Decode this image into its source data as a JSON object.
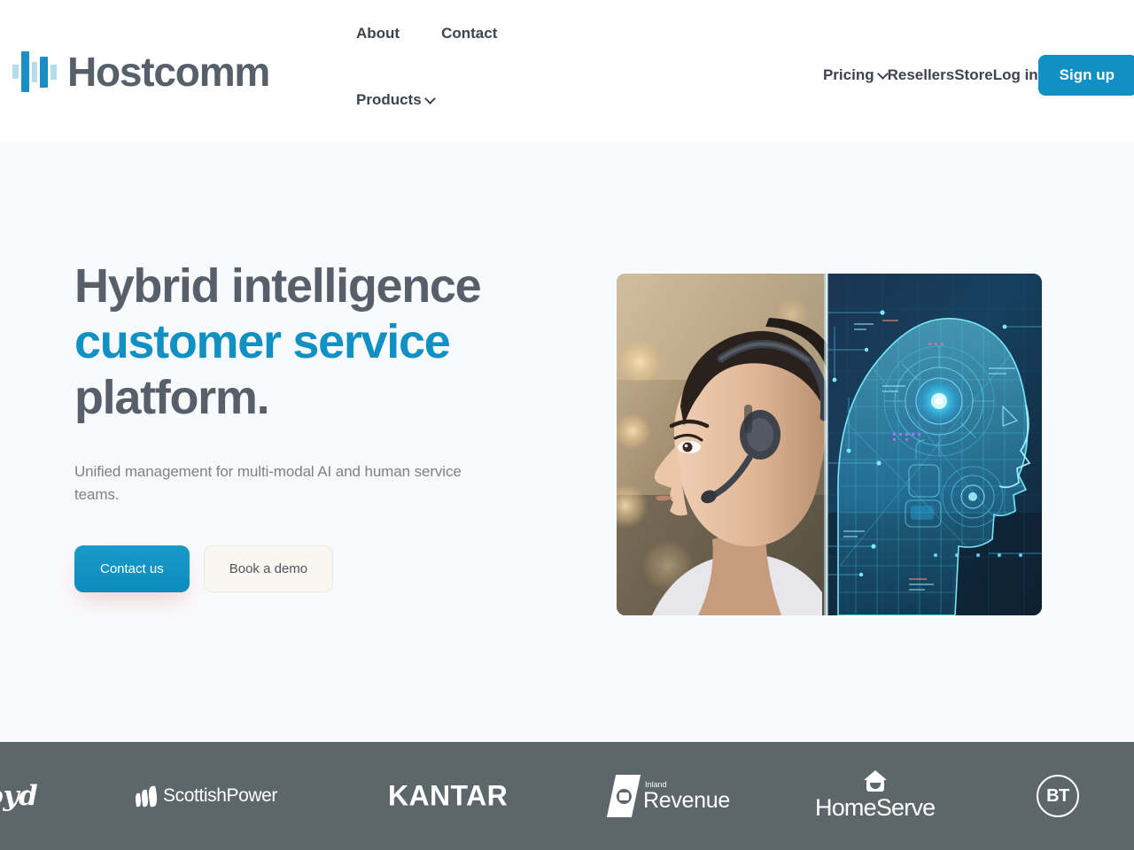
{
  "header": {
    "logo": {
      "wordmark": "Hostcomm",
      "bar_color_dark": "#1b8fc4",
      "bar_color_light": "#b4dced"
    },
    "nav_primary": [
      {
        "label": "About",
        "has_dropdown": false
      },
      {
        "label": "Contact",
        "has_dropdown": false
      },
      {
        "label": "Products",
        "has_dropdown": true
      }
    ],
    "nav_secondary": [
      {
        "label": "Pricing",
        "has_dropdown": true
      },
      {
        "label": "Resellers",
        "has_dropdown": false
      },
      {
        "label": "Store",
        "has_dropdown": false
      },
      {
        "label": "Log in",
        "has_dropdown": false
      }
    ],
    "signup_label": "Sign up",
    "signup_color": "#1190c4"
  },
  "hero": {
    "heading_line1": "Hybrid intelligence",
    "heading_line2": "customer service",
    "heading_line3": "platform.",
    "heading_accent_color": "#1190c4",
    "heading_color": "#57606a",
    "subtitle": "Unified management for multi-modal AI and human service teams.",
    "primary_cta": "Contact us",
    "secondary_cta": "Book a demo",
    "background_color": "#f9fafd",
    "image": {
      "alt": "Split composition: call centre agent wearing a headset on the left, glowing blue AI wireframe head on the right",
      "left_description": "woman with headset, warm bokeh office background",
      "right_description": "cyan digital wireframe head with circuit overlay"
    }
  },
  "logo_band": {
    "background_color": "#5c666b",
    "brands": [
      {
        "name": "Lloyds",
        "visible_text": "loyd",
        "note": "clipped at left edge"
      },
      {
        "name": "ScottishPower",
        "visible_text": "ScottishPower"
      },
      {
        "name": "Kantar",
        "visible_text": "KANTAR"
      },
      {
        "name": "Inland Revenue",
        "visible_text_small": "Inland",
        "visible_text": "Revenue"
      },
      {
        "name": "HomeServe",
        "visible_text": "HomeServe"
      },
      {
        "name": "BT",
        "visible_text": "BT"
      }
    ]
  }
}
